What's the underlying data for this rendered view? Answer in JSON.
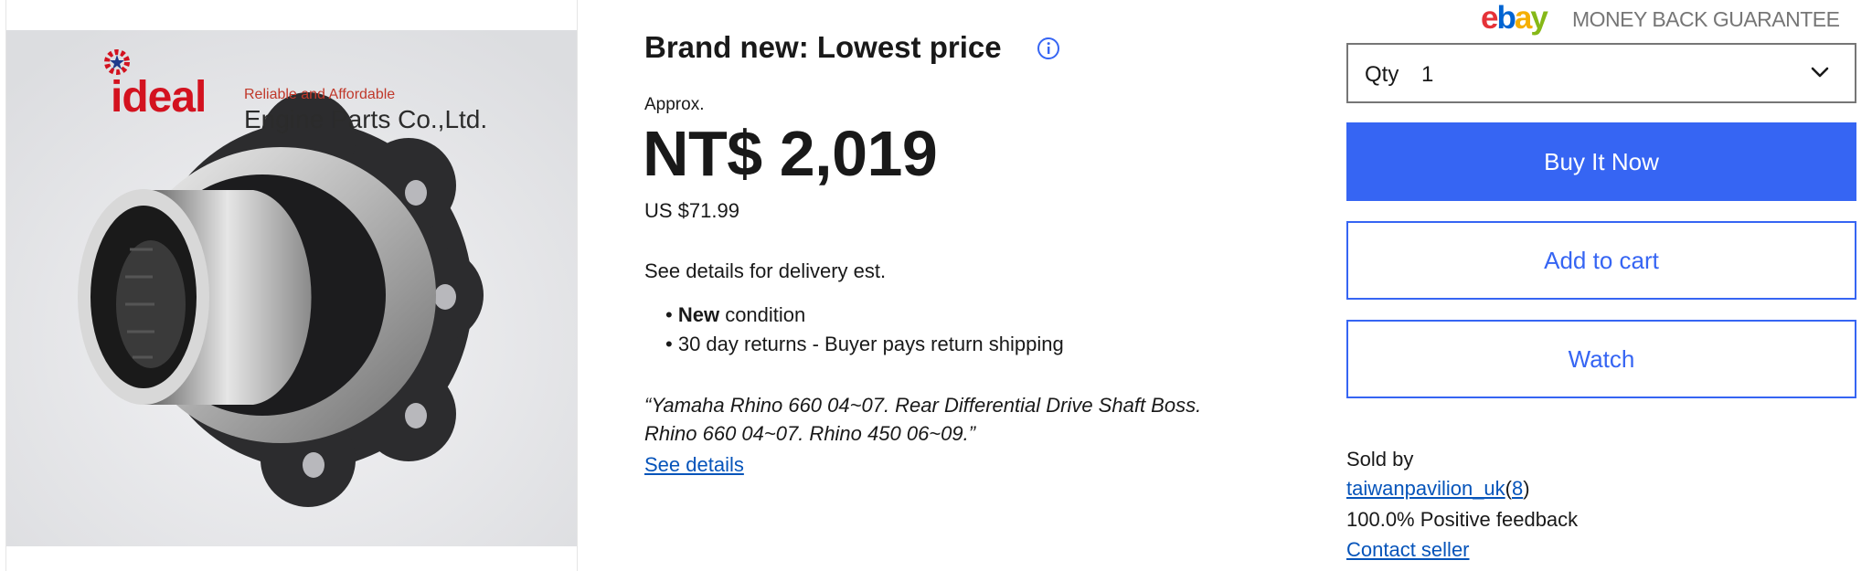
{
  "image": {
    "logo_word": "ideal",
    "logo_tagline": "Reliable and Affordable",
    "logo_company": "Engine Parts Co.,Ltd."
  },
  "listing": {
    "heading": "Brand new: Lowest price",
    "approx": "Approx.",
    "price": "NT$ 2,019",
    "usd": "US $71.99",
    "delivery": "See details for delivery est.",
    "bullets": [
      {
        "bold": "New",
        "rest": " condition"
      },
      {
        "bold": "",
        "rest": "30 day returns - Buyer pays return shipping"
      }
    ],
    "quote_line1": "“Yamaha Rhino 660 04~07. Rear Differential Drive Shaft Boss.",
    "quote_line2": "Rhino 660 04~07. Rhino 450 06~09.”",
    "see_details": "See details"
  },
  "guarantee": {
    "logo_letters": [
      "e",
      "b",
      "a",
      "y"
    ],
    "logo_colors": [
      "#e53238",
      "#0064d2",
      "#f5af02",
      "#86b817"
    ],
    "text": "MONEY BACK GUARANTEE"
  },
  "purchase": {
    "qty_label": "Qty",
    "qty_value": "1",
    "buy_now": "Buy It Now",
    "add_to_cart": "Add to cart",
    "watch": "Watch"
  },
  "seller": {
    "sold_by": "Sold by",
    "name": "taiwanpavilion_uk",
    "open_paren": "(",
    "score": "8",
    "close_paren": ")",
    "feedback": "100.0% Positive feedback",
    "contact": "Contact seller"
  },
  "icons": {
    "info": "info-circle-icon",
    "chevron": "chevron-down-icon"
  },
  "colors": {
    "accent": "#3665f3",
    "link": "#0654ba",
    "text": "#191919"
  }
}
